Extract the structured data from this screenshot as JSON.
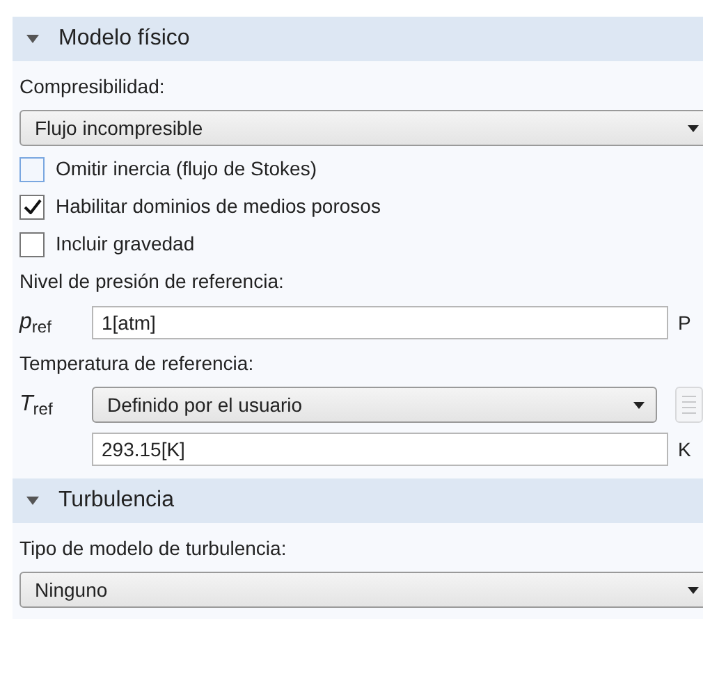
{
  "sections": [
    {
      "title": "Modelo físico",
      "expanded": true,
      "items": [
        {
          "kind": "label",
          "text": "Compresibilidad:"
        },
        {
          "kind": "select",
          "value": "Flujo incompresible"
        },
        {
          "kind": "checkbox",
          "label": "Omitir inercia (flujo de Stokes)",
          "checked": false,
          "highlighted": true
        },
        {
          "kind": "checkbox",
          "label": "Habilitar dominios de medios porosos",
          "checked": true,
          "highlighted": false
        },
        {
          "kind": "checkbox",
          "label": "Incluir gravedad",
          "checked": false,
          "highlighted": false
        },
        {
          "kind": "label",
          "text": "Nivel de presión de referencia:"
        },
        {
          "kind": "field",
          "symbol": "*p*$_{ref}$",
          "value": "1[atm]",
          "unit": "P"
        },
        {
          "kind": "label",
          "text": "Temperatura de referencia:"
        },
        {
          "kind": "select",
          "symbol": "*T*$_{ref}$",
          "value": "Definido por el usuario",
          "button": {
            "disabled": true
          }
        },
        {
          "kind": "field",
          "value": "293.15[K]",
          "unit": "K"
        }
      ]
    },
    {
      "title": "Turbulencia",
      "expanded": true,
      "items": [
        {
          "kind": "label",
          "text": "Tipo de modelo de turbulencia:"
        },
        {
          "kind": "select",
          "value": "Ninguno"
        }
      ]
    }
  ]
}
